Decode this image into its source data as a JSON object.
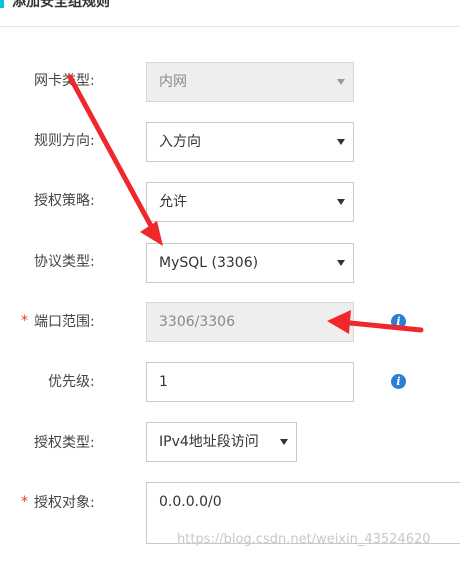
{
  "header": {
    "title": "添加安全组规则"
  },
  "form": {
    "nic_type": {
      "label": "网卡类型:",
      "value": "内网"
    },
    "direction": {
      "label": "规则方向:",
      "value": "入方向"
    },
    "policy": {
      "label": "授权策略:",
      "value": "允许"
    },
    "protocol": {
      "label": "协议类型:",
      "value": "MySQL (3306)"
    },
    "port_range": {
      "label": "端口范围:",
      "value": "3306/3306",
      "required_mark": "*"
    },
    "priority": {
      "label": "优先级:",
      "value": "1"
    },
    "auth_type": {
      "label": "授权类型:",
      "value": "IPv4地址段访问"
    },
    "auth_object": {
      "label": "授权对象:",
      "value": "0.0.0.0/0",
      "required_mark": "*"
    }
  },
  "info_icon_glyph": "i",
  "watermark": "https://blog.csdn.net/weixin_43524620",
  "colors": {
    "accent": "#00c1de",
    "info": "#2a7fd4",
    "arrow": "#f0282d",
    "required": "#e4393c"
  }
}
